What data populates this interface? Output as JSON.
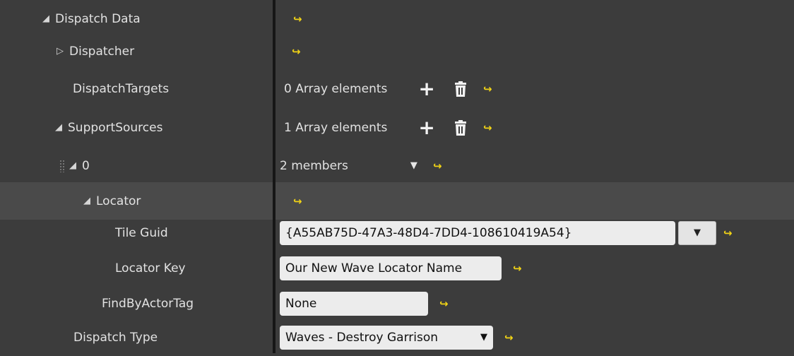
{
  "rows": {
    "dispatch_data": {
      "name": "Dispatch Data"
    },
    "dispatcher": {
      "name": "Dispatcher"
    },
    "dispatch_targets": {
      "name": "DispatchTargets",
      "value": "0 Array elements"
    },
    "support_sources": {
      "name": "SupportSources",
      "value": "1 Array elements"
    },
    "element_0": {
      "name": "0",
      "value": "2 members"
    },
    "locator": {
      "name": "Locator"
    },
    "tile_guid": {
      "name": "Tile Guid",
      "value": "{A55AB75D-47A3-48D4-7DD4-108610419A54}"
    },
    "locator_key": {
      "name": "Locator Key",
      "value": "Our New Wave Locator Name"
    },
    "find_by_actor_tag": {
      "name": "FindByActorTag",
      "value": "None"
    },
    "dispatch_type": {
      "name": "Dispatch Type",
      "value": "Waves - Destroy Garrison"
    }
  },
  "icons": {
    "reset": "reset-to-default-icon",
    "add": "add-element-icon",
    "delete": "delete-all-elements-icon",
    "expanded": "expanded-triangle-icon",
    "collapsed": "collapsed-triangle-icon",
    "combo": "combo-arrow-icon"
  },
  "colors": {
    "background": "#3c3c3c",
    "highlight_row": "#4a4a4a",
    "reset_icon": "#f1d316",
    "field_bg": "#ececec"
  }
}
